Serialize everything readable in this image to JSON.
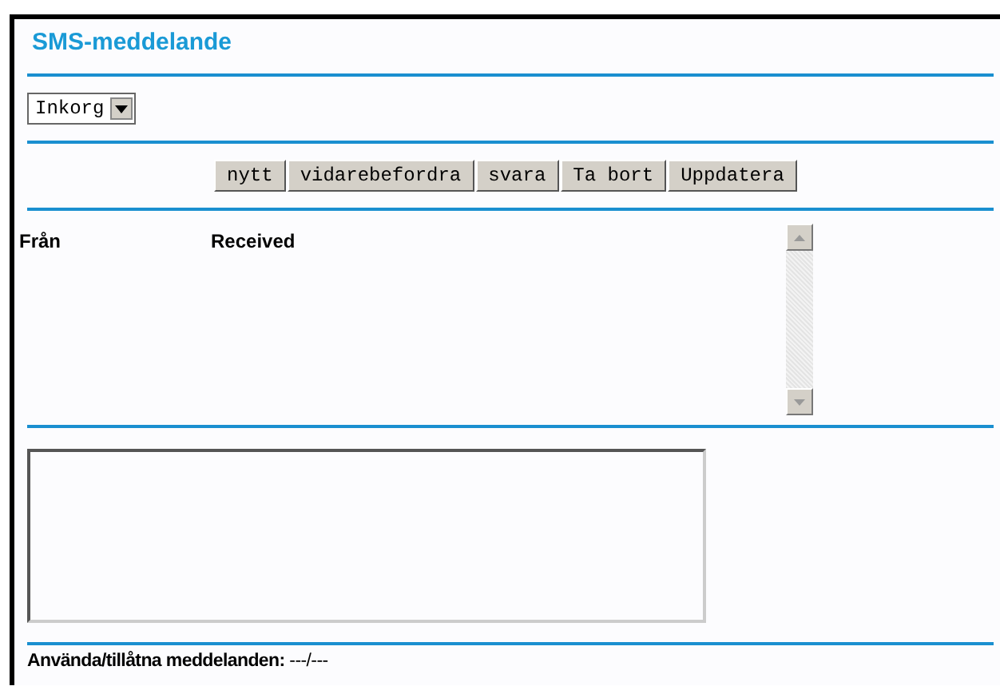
{
  "title": "SMS-meddelande",
  "folder_select": {
    "value": "Inkorg"
  },
  "buttons": [
    "nytt",
    "vidarebefordra",
    "svara",
    "Ta bort",
    "Uppdatera"
  ],
  "table": {
    "columns": [
      "Från",
      "Received"
    ]
  },
  "footer": "**Använda/tillåtna meddelanden:** ---/---"
}
